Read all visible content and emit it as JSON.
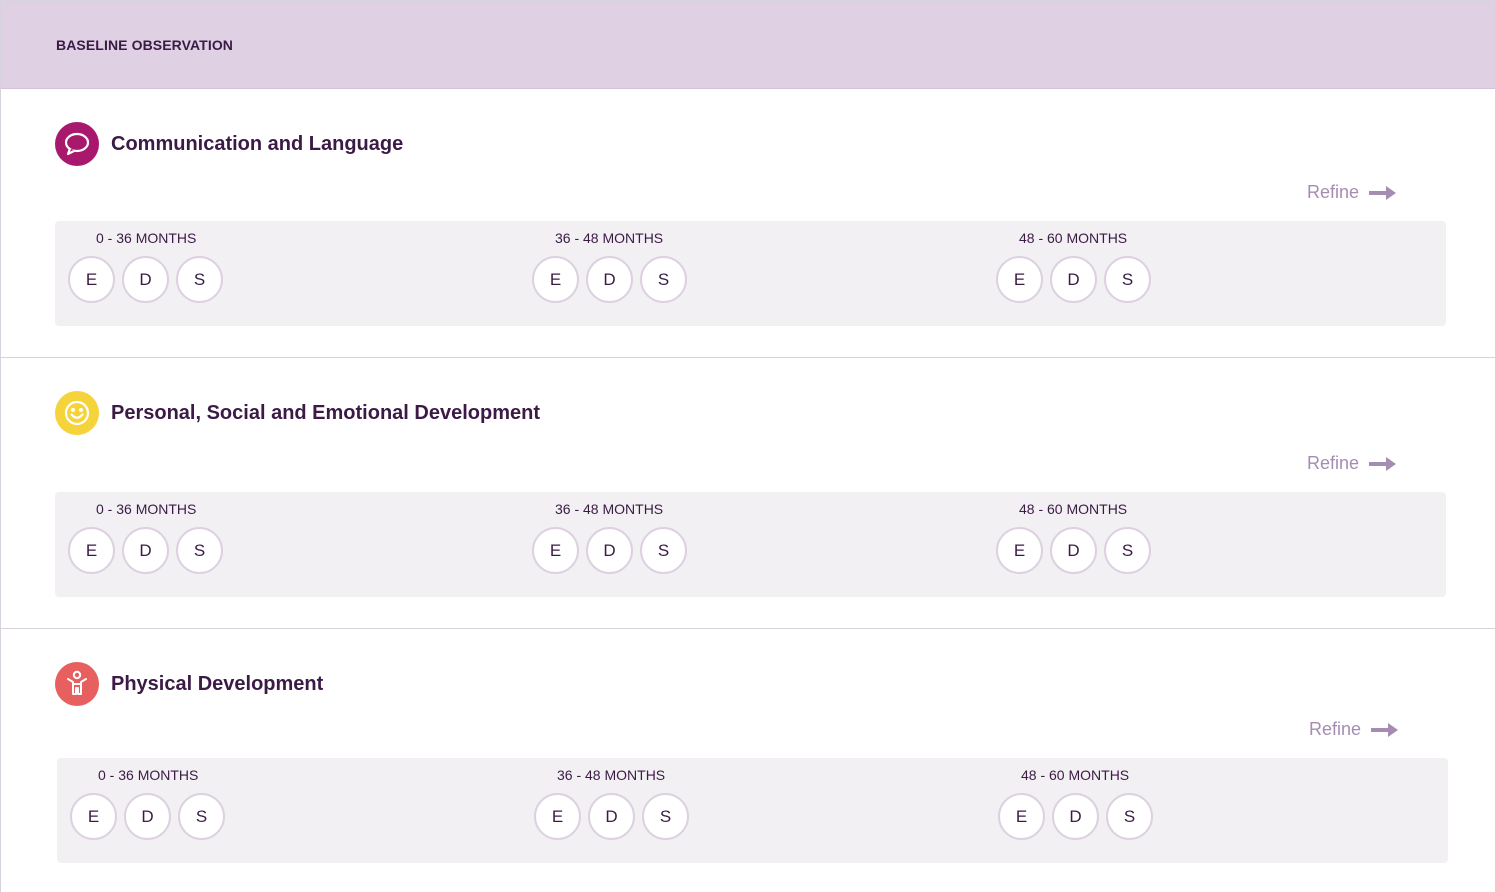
{
  "header": {
    "title": "BASELINE OBSERVATION"
  },
  "sections": [
    {
      "title": "Communication and Language",
      "icon": "speech-bubble-icon",
      "icon_color": "#a8196e",
      "refine_label": "Refine",
      "bands": [
        {
          "label": "0 - 36 MONTHS",
          "options": [
            "E",
            "D",
            "S"
          ]
        },
        {
          "label": "36 - 48 MONTHS",
          "options": [
            "E",
            "D",
            "S"
          ]
        },
        {
          "label": "48 - 60 MONTHS",
          "options": [
            "E",
            "D",
            "S"
          ]
        }
      ]
    },
    {
      "title": "Personal, Social and Emotional Development",
      "icon": "smiley-face-icon",
      "icon_color": "#f5d33a",
      "refine_label": "Refine",
      "bands": [
        {
          "label": "0 - 36 MONTHS",
          "options": [
            "E",
            "D",
            "S"
          ]
        },
        {
          "label": "36 - 48 MONTHS",
          "options": [
            "E",
            "D",
            "S"
          ]
        },
        {
          "label": "48 - 60 MONTHS",
          "options": [
            "E",
            "D",
            "S"
          ]
        }
      ]
    },
    {
      "title": "Physical Development",
      "icon": "person-icon",
      "icon_color": "#e85f5f",
      "refine_label": "Refine",
      "bands": [
        {
          "label": "0 - 36 MONTHS",
          "options": [
            "E",
            "D",
            "S"
          ]
        },
        {
          "label": "36 - 48 MONTHS",
          "options": [
            "E",
            "D",
            "S"
          ]
        },
        {
          "label": "48 - 60 MONTHS",
          "options": [
            "E",
            "D",
            "S"
          ]
        }
      ]
    }
  ],
  "colors": {
    "header_bg": "#dfd1e3",
    "text": "#3b1a45",
    "refine": "#a58db1",
    "band_bg": "#f2f0f3",
    "pill_border": "#dcd0e1"
  }
}
